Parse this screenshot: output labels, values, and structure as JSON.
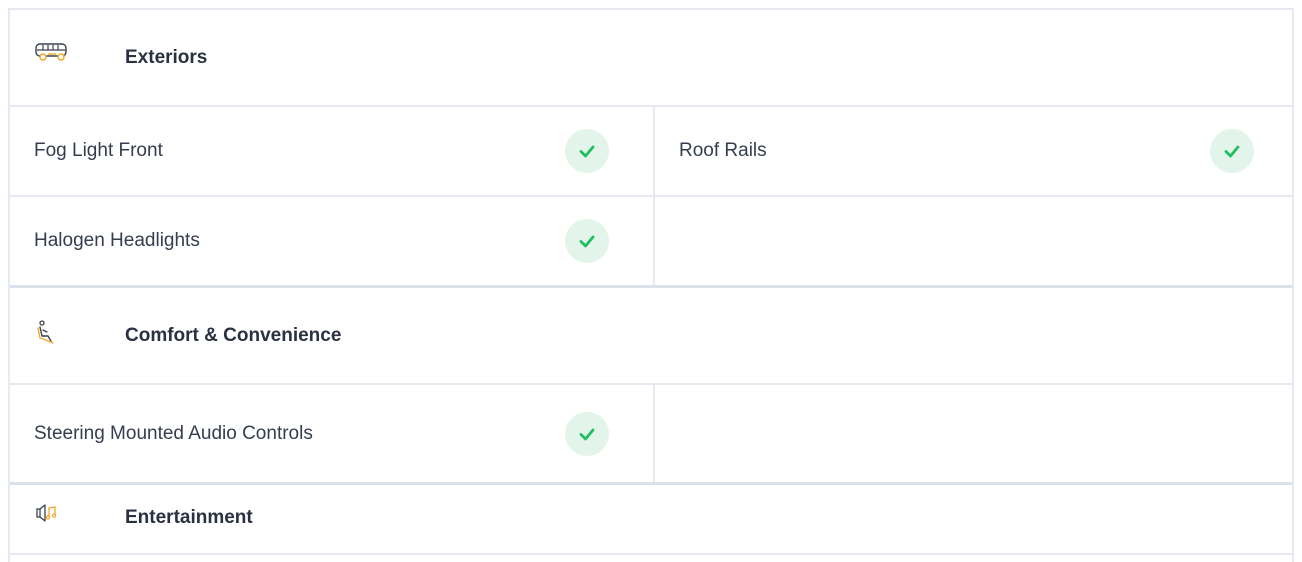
{
  "sections": [
    {
      "icon": "car-icon",
      "title": "Exteriors",
      "rows": [
        {
          "left": {
            "label": "Fog Light Front",
            "available": true
          },
          "right": {
            "label": "Roof Rails",
            "available": true
          }
        },
        {
          "left": {
            "label": "Halogen Headlights",
            "available": true
          },
          "right": {
            "label": "",
            "available": false
          }
        }
      ]
    },
    {
      "icon": "seat-icon",
      "title": "Comfort & Convenience",
      "rows": [
        {
          "left": {
            "label": "Steering Mounted Audio Controls",
            "available": true
          },
          "right": {
            "label": "",
            "available": false
          }
        }
      ]
    },
    {
      "icon": "speaker-music-icon",
      "title": "Entertainment",
      "rows": []
    }
  ],
  "colors": {
    "check_bg": "#e3f5ea",
    "check_mark": "#1fbf5f",
    "border": "#e6eaf0",
    "icon_accent": "#f5a623"
  }
}
